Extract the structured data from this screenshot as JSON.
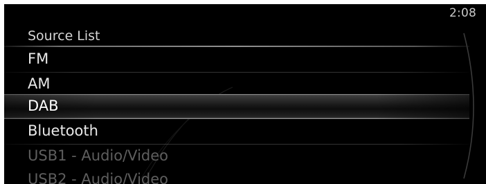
{
  "status_bar": {
    "time": "2:08"
  },
  "source_list": {
    "title": "Source List",
    "items": [
      {
        "label": "FM",
        "state": "enabled"
      },
      {
        "label": "AM",
        "state": "enabled"
      },
      {
        "label": "DAB",
        "state": "selected"
      },
      {
        "label": "Bluetooth",
        "state": "enabled"
      },
      {
        "label": "USB1 - Audio/Video",
        "state": "disabled"
      },
      {
        "label": "USB2 - Audio/Video",
        "state": "disabled"
      }
    ]
  },
  "colors": {
    "background": "#000000",
    "text_enabled": "#e8e8e8",
    "text_disabled": "#5e5e5e",
    "highlight": "#3a3a3a"
  }
}
